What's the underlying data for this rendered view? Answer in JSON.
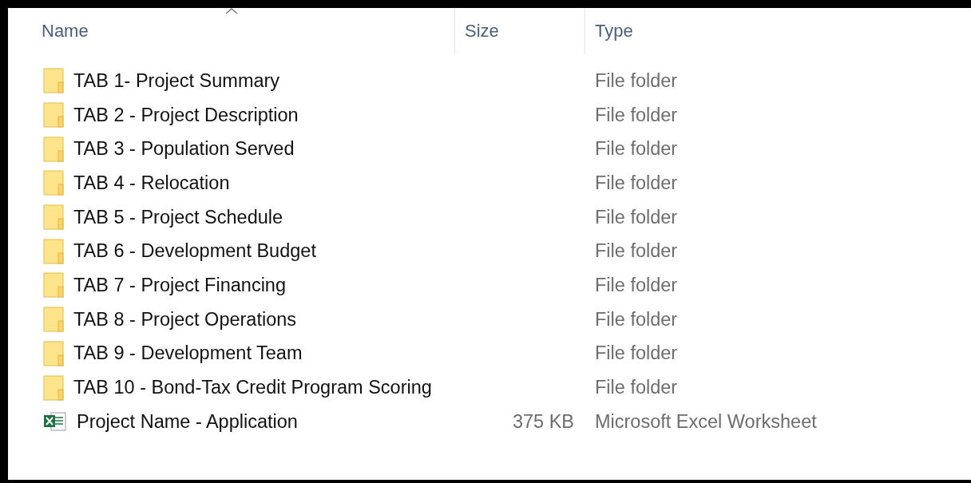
{
  "columns": [
    {
      "label": "Name",
      "sorted": true
    },
    {
      "label": "Size",
      "sorted": false
    },
    {
      "label": "Type",
      "sorted": false
    }
  ],
  "files": [
    {
      "kind": "folder",
      "name": "TAB 1- Project Summary",
      "type": "File folder"
    },
    {
      "kind": "folder",
      "name": "TAB 2 - Project Description",
      "type": "File folder"
    },
    {
      "kind": "folder",
      "name": "TAB 3 - Population Served",
      "type": "File folder"
    },
    {
      "kind": "folder",
      "name": "TAB 4 - Relocation",
      "type": "File folder"
    },
    {
      "kind": "folder",
      "name": "TAB 5 - Project Schedule",
      "type": "File folder"
    },
    {
      "kind": "folder",
      "name": "TAB 6 - Development Budget",
      "type": "File folder"
    },
    {
      "kind": "folder",
      "name": "TAB 7 - Project Financing",
      "type": "File folder"
    },
    {
      "kind": "folder",
      "name": "TAB 8 - Project Operations",
      "type": "File folder"
    },
    {
      "kind": "folder",
      "name": "TAB 9 - Development Team",
      "type": "File folder"
    },
    {
      "kind": "folder",
      "name": "TAB 10 - Bond-Tax Credit Program Scoring",
      "type": "File folder"
    },
    {
      "kind": "spreadsheet",
      "name": "Project Name - Application",
      "size": "375 KB",
      "type": "Microsoft Excel Worksheet"
    }
  ]
}
